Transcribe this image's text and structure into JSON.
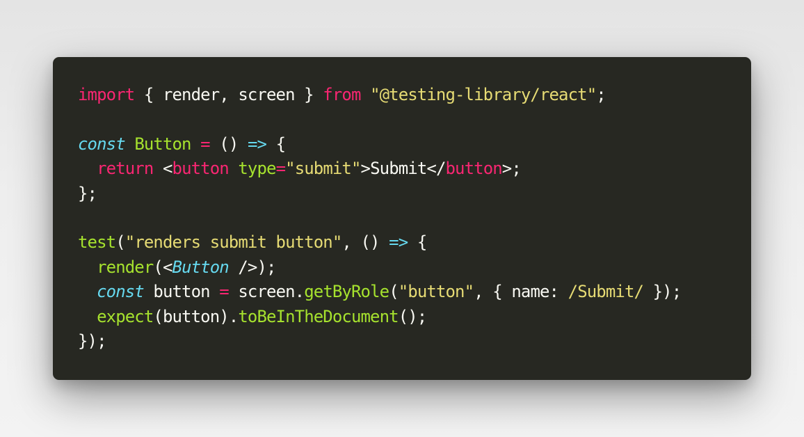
{
  "theme": {
    "background": "#272822",
    "keyword": "#f92672",
    "string": "#e6db74",
    "function": "#a6e22e",
    "storage": "#66d9ef",
    "text": "#f8f8f2"
  },
  "code_lines": [
    [
      {
        "t": "import",
        "c": "kw"
      },
      {
        "t": " { render, screen } ",
        "c": "pl"
      },
      {
        "t": "from",
        "c": "kw"
      },
      {
        "t": " ",
        "c": "pl"
      },
      {
        "t": "\"@testing-library/react\"",
        "c": "str"
      },
      {
        "t": ";",
        "c": "pl"
      }
    ],
    [],
    [
      {
        "t": "const",
        "c": "it"
      },
      {
        "t": " ",
        "c": "pl"
      },
      {
        "t": "Button",
        "c": "fn"
      },
      {
        "t": " ",
        "c": "pl"
      },
      {
        "t": "=",
        "c": "op"
      },
      {
        "t": " () ",
        "c": "pl"
      },
      {
        "t": "=>",
        "c": "ar"
      },
      {
        "t": " {",
        "c": "pl"
      }
    ],
    [
      {
        "t": "  ",
        "c": "pl"
      },
      {
        "t": "return",
        "c": "kw"
      },
      {
        "t": " <",
        "c": "pl"
      },
      {
        "t": "button",
        "c": "kw"
      },
      {
        "t": " ",
        "c": "pl"
      },
      {
        "t": "type",
        "c": "fn"
      },
      {
        "t": "=",
        "c": "op"
      },
      {
        "t": "\"submit\"",
        "c": "str"
      },
      {
        "t": ">Submit</",
        "c": "pl"
      },
      {
        "t": "button",
        "c": "kw"
      },
      {
        "t": ">;",
        "c": "pl"
      }
    ],
    [
      {
        "t": "};",
        "c": "pl"
      }
    ],
    [],
    [
      {
        "t": "test",
        "c": "fn"
      },
      {
        "t": "(",
        "c": "pl"
      },
      {
        "t": "\"renders submit button\"",
        "c": "str"
      },
      {
        "t": ", () ",
        "c": "pl"
      },
      {
        "t": "=>",
        "c": "ar"
      },
      {
        "t": " {",
        "c": "pl"
      }
    ],
    [
      {
        "t": "  ",
        "c": "pl"
      },
      {
        "t": "render",
        "c": "fn"
      },
      {
        "t": "(<",
        "c": "pl"
      },
      {
        "t": "Button",
        "c": "it"
      },
      {
        "t": " />);",
        "c": "pl"
      }
    ],
    [
      {
        "t": "  ",
        "c": "pl"
      },
      {
        "t": "const",
        "c": "it"
      },
      {
        "t": " button ",
        "c": "pl"
      },
      {
        "t": "=",
        "c": "op"
      },
      {
        "t": " screen.",
        "c": "pl"
      },
      {
        "t": "getByRole",
        "c": "fn"
      },
      {
        "t": "(",
        "c": "pl"
      },
      {
        "t": "\"button\"",
        "c": "str"
      },
      {
        "t": ", { name: ",
        "c": "pl"
      },
      {
        "t": "/Submit/",
        "c": "str"
      },
      {
        "t": " });",
        "c": "pl"
      }
    ],
    [
      {
        "t": "  ",
        "c": "pl"
      },
      {
        "t": "expect",
        "c": "fn"
      },
      {
        "t": "(button).",
        "c": "pl"
      },
      {
        "t": "toBeInTheDocument",
        "c": "fn"
      },
      {
        "t": "();",
        "c": "pl"
      }
    ],
    [
      {
        "t": "});",
        "c": "pl"
      }
    ]
  ]
}
